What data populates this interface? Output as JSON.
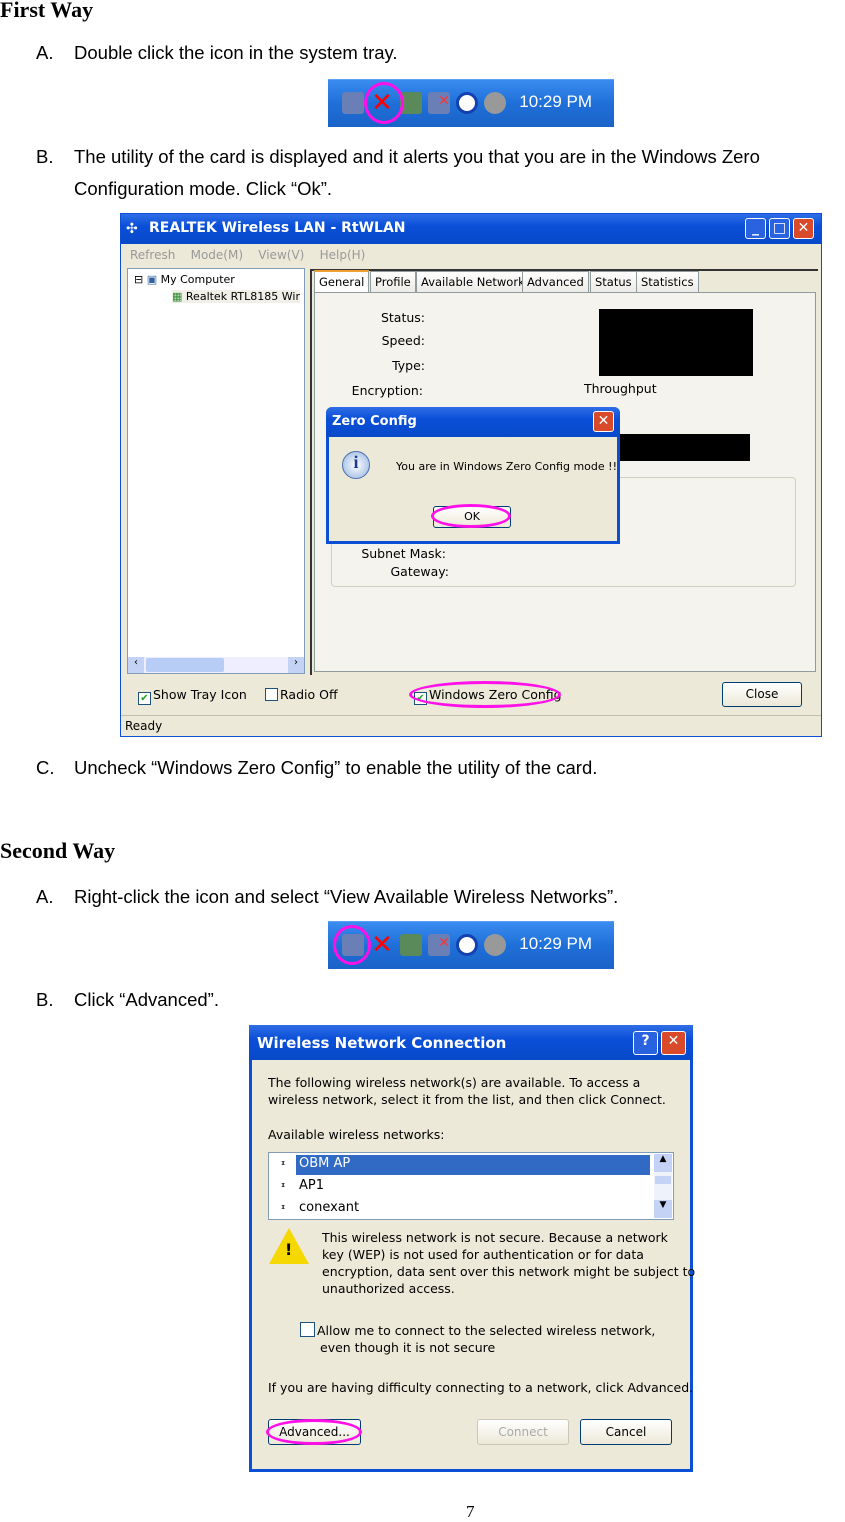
{
  "first_way": {
    "heading": "First Way",
    "step_a": {
      "letter": "A.",
      "text": "Double click the icon in the system tray."
    },
    "step_b": {
      "letter": "B.",
      "text": "The utility of the card is displayed and it alerts you that you are in the Windows Zero",
      "text2": "Configuration mode. Click “Ok”."
    },
    "step_c": {
      "letter": "C.",
      "text": "Uncheck “Windows Zero Config” to enable the utility of the card."
    }
  },
  "tray": {
    "time": "10:29 PM",
    "icons": [
      "network-icon",
      "wireless-disabled-icon",
      "safely-remove-icon",
      "network-disconnected-icon",
      "globe-icon",
      "speaker-icon"
    ],
    "highlight_color": "#ff10e8"
  },
  "rtwlan": {
    "title": "REALTEK Wireless LAN - RtWLAN",
    "menu": [
      "Refresh",
      "Mode(M)",
      "View(V)",
      "Help(H)"
    ],
    "tree": {
      "root": "My Computer",
      "child": "Realtek RTL8185 Wir"
    },
    "tabs": [
      "General",
      "Profile",
      "Available Network",
      "Advanced",
      "Status",
      "Statistics"
    ],
    "labels": {
      "status": "Status:",
      "speed": "Speed:",
      "type": "Type:",
      "encryption": "Encryption:",
      "throughput": "Throughput",
      "subnet": "Subnet Mask:",
      "gateway": "Gateway:"
    },
    "show_tray_icon": "Show Tray Icon",
    "radio_off": "Radio Off",
    "wzc": "Windows Zero Config",
    "close": "Close",
    "status_bar": "Ready",
    "dialog": {
      "title": "Zero Config",
      "message": "You are in Windows Zero Config mode !!",
      "ok": "OK"
    }
  },
  "second_way": {
    "heading": "Second Way",
    "step_a": {
      "letter": "A.",
      "text": "Right-click the icon and select “View Available Wireless Networks”."
    },
    "step_b": {
      "letter": "B.",
      "text": "Click “Advanced”."
    }
  },
  "wnc": {
    "title": "Wireless Network Connection",
    "intro1": "The following wireless network(s) are available. To access a",
    "intro2": "wireless network, select it from the list, and then click Connect.",
    "list_label": "Available wireless networks:",
    "networks": [
      "OBM AP",
      "AP1",
      "conexant"
    ],
    "warning": [
      "This wireless network is not secure. Because a network",
      "key (WEP) is not used for authentication or for data",
      "encryption, data sent over this network might be subject to",
      "unauthorized access."
    ],
    "allow1": "Allow me to connect to the selected wireless network,",
    "allow2": "even though it is not secure",
    "help": "If you are having difficulty connecting to a network, click Advanced.",
    "advanced": "Advanced...",
    "connect": "Connect",
    "cancel": "Cancel"
  },
  "page_number": "7"
}
